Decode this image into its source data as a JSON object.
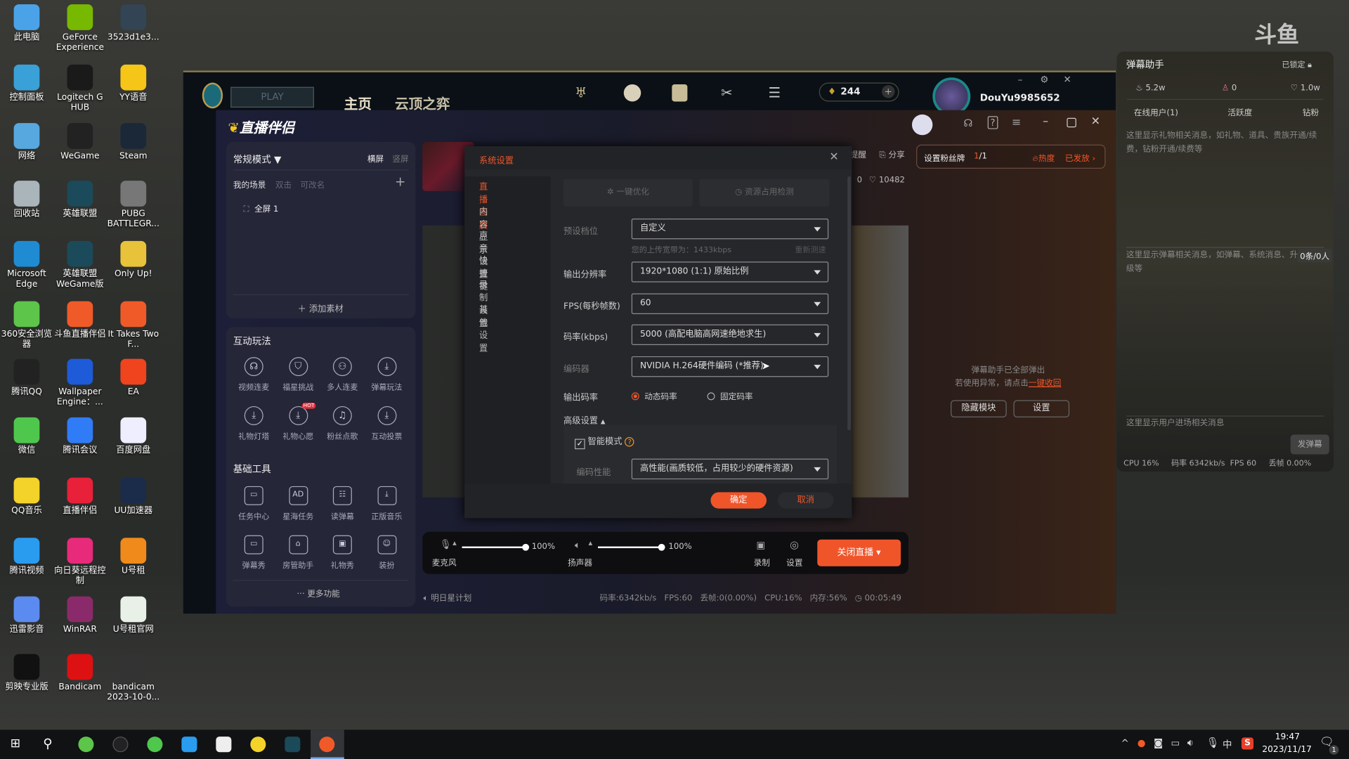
{
  "desktop": {
    "icons": [
      [
        "此电脑",
        "#4aa3e8"
      ],
      [
        "控制面板",
        "#3aa0d8"
      ],
      [
        "网络",
        "#58a8e0"
      ],
      [
        "回收站",
        "#aab4bb"
      ],
      [
        "Microsoft Edge",
        "#1f8bd3"
      ],
      [
        "360安全浏览器",
        "#5cc54a"
      ],
      [
        "腾讯QQ",
        "#222"
      ],
      [
        "微信",
        "#4fc74d"
      ],
      [
        "QQ音乐",
        "#f3d22a"
      ],
      [
        "腾讯视频",
        "#2a9cf0"
      ],
      [
        "迅雷影音",
        "#5b8bf0"
      ],
      [
        "剪映专业版",
        "#111"
      ],
      [
        "GeForce Experience",
        "#76b900"
      ],
      [
        "Logitech G HUB",
        "#1a1a1a"
      ],
      [
        "WeGame",
        "#222"
      ],
      [
        "英雄联盟",
        "#1b4a5a"
      ],
      [
        "英雄联盟WeGame版",
        "#1b4a5a"
      ],
      [
        "斗鱼直播伴侣",
        "#f05a28"
      ],
      [
        "Wallpaper Engine：...",
        "#1e5bd8"
      ],
      [
        "腾讯会议",
        "#2f7cf6"
      ],
      [
        "直播伴侣",
        "#e8203a"
      ],
      [
        "向日葵远程控制",
        "#e82a7a"
      ],
      [
        "WinRAR",
        "#8b2a6a"
      ],
      [
        "Bandicam",
        "#d11"
      ],
      [
        "3523d1e3...",
        "#345"
      ],
      [
        "YY语音",
        "#f5c518"
      ],
      [
        "Steam",
        "#1b2838"
      ],
      [
        "PUBG BATTLEGR...",
        "#777"
      ],
      [
        "Only Up!",
        "#e8c23a"
      ],
      [
        "It Takes Two F...",
        "#f05a28"
      ],
      [
        "EA",
        "#f0441e"
      ],
      [
        "百度网盘",
        "#eef"
      ],
      [
        "UU加速器",
        "#1b2b4a"
      ],
      [
        "U号租",
        "#f08a1a"
      ],
      [
        "U号租官网",
        "#e8f0e8"
      ],
      [
        "bandicam 2023-10-0...",
        "#333"
      ]
    ]
  },
  "lol": {
    "play": "PLAY",
    "nav": [
      "主页",
      "云顶之弈"
    ],
    "currency": "244",
    "username": "DouYu9985652"
  },
  "app": {
    "logo": "直播伴侣",
    "mode": "常规模式",
    "orient_h": "横屏",
    "orient_v": "竖屏",
    "scenes_title": "我的场景",
    "scenes_hint1": "双击",
    "scenes_hint2": "可改名",
    "scene": "全屏 1",
    "add_source": "添加素材",
    "interactive_title": "互动玩法",
    "interactive": [
      "视频连麦",
      "福星挑战",
      "多人连麦",
      "弹幕玩法",
      "礼物灯塔",
      "礼物心愿",
      "粉丝点歌",
      "互动投票"
    ],
    "hot_badge": "HOT",
    "tools_title": "基础工具",
    "tools": [
      "任务中心",
      "星海任务",
      "读弹幕",
      "正版音乐",
      "弹幕秀",
      "房管助手",
      "礼物秀",
      "装扮"
    ],
    "more": "更多功能",
    "remind": "提醒",
    "share": "分享",
    "count_a": "0",
    "likes": "10482",
    "mic_label": "麦克风",
    "mic_vol": "100%",
    "spk_label": "扬声器",
    "spk_vol": "100%",
    "mic_level": 1.0,
    "spk_level": 1.0,
    "record": "录制",
    "settings": "设置",
    "stop_live": "关闭直播",
    "status": {
      "plan": "明日星计划",
      "bitrate": "码率:6342kb/s",
      "fps": "FPS:60",
      "drop": "丢帧:0(0.00%)",
      "cpu": "CPU:16%",
      "mem": "内存:56%",
      "time": "00:05:49"
    },
    "fan_badge": "设置粉丝牌",
    "fan_count_cur": "1",
    "fan_count_total": "/1",
    "heat": "热度",
    "issued": "已发放",
    "popped1": "弹幕助手已全部弹出",
    "popped2": "若使用异常，请点击",
    "recall": "一键收回",
    "hide_module": "隐藏模块",
    "module_settings": "设置"
  },
  "dialog": {
    "title": "系统设置",
    "nav": [
      "直播画质",
      "内容显示",
      "声音设置",
      "快捷键",
      "录制设置",
      "其他设置"
    ],
    "active_nav": "直播画质",
    "optimize": "一键优化",
    "resource_check": "资源占用检测",
    "preset_label": "预设档位",
    "preset": "自定义",
    "bandwidth": "您的上传宽带为：1433kbps",
    "retest": "重新测速",
    "res_label": "输出分辨率",
    "res": "1920*1080 (1:1) 原始比例",
    "fps_label": "FPS(每秒帧数)",
    "fps": "60",
    "bitrate_label": "码率(kbps)",
    "bitrate": "5000 (高配电脑高网速绝地求生)",
    "encoder_label": "编码器",
    "encoder": "NVIDIA H.264硬件编码 (*推荐)",
    "rate_label": "输出码率",
    "rate_dynamic": "动态码率",
    "rate_fixed": "固定码率",
    "rate_selected": "动态码率",
    "advanced": "高级设置",
    "smart_mode": "智能模式",
    "smart_checked": true,
    "perf_label": "编码性能",
    "perf": "高性能(画质较低，占用较少的硬件资源)",
    "ok": "确定",
    "cancel": "取消"
  },
  "helper": {
    "title": "弹幕助手",
    "locked": "已锁定",
    "heat": "5.2w",
    "users": "0",
    "likes": "1.0w",
    "tabs": [
      "在线用户(1)",
      "活跃度",
      "钻粉"
    ],
    "gift_msg": "这里显示礼物相关消息，如礼物、道具、贵族开通/续费，钻粉开通/续费等",
    "danmu_msg": "这里显示弹幕相关消息，如弹幕、系统消息、升级等",
    "danmu_count": "0条/0人",
    "enter_msg": "这里显示用户进场相关消息",
    "send": "发弹幕",
    "stats": {
      "cpu": "CPU 16%",
      "bitrate": "码率 6342kb/s",
      "fps": "FPS 60",
      "drop": "丢帧 0.00%"
    }
  },
  "taskbar": {
    "ime": "中",
    "time": "19:47",
    "date": "2023/11/17",
    "notifications": "1"
  },
  "colors": {
    "accent": "#f0552a",
    "panel": "#252638"
  }
}
